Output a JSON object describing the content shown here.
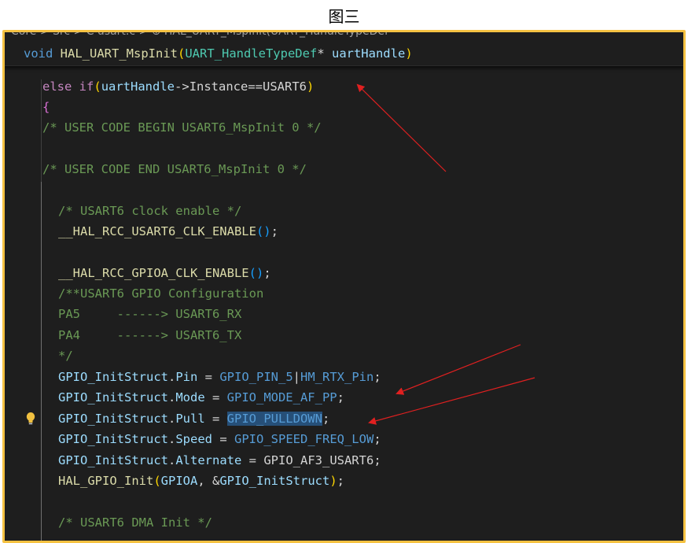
{
  "caption": "图三",
  "breadcrumb": "Core > Src > C usart.c > ⊕ HAL_UART_MspInit(UART_HandleTypeDef *",
  "sticky": {
    "t1": "void",
    "t2": "HAL_UART_MspInit",
    "t3": "(",
    "t4": "UART_HandleTypeDef",
    "t5": "* ",
    "t6": "uartHandle",
    "t7": ")"
  },
  "lines": {
    "l1": {
      "t1": "else",
      "t2": " ",
      "t3": "if",
      "t4": "(",
      "t5": "uartHandle",
      "t6": "->",
      "t7": "Instance",
      "t8": "==",
      "t9": "USART6",
      "t10": ")"
    },
    "l2": {
      "t1": "{"
    },
    "l3": {
      "t1": "/* USER CODE BEGIN USART6_MspInit 0 */"
    },
    "l5": {
      "t1": "/* USER CODE END USART6_MspInit 0 */"
    },
    "l7": {
      "t1": "/* USART6 clock enable */"
    },
    "l8": {
      "t1": "__HAL_RCC_USART6_CLK_ENABLE",
      "t2": "()",
      "t3": ";"
    },
    "l10": {
      "t1": "__HAL_RCC_GPIOA_CLK_ENABLE",
      "t2": "()",
      "t3": ";"
    },
    "l11": {
      "t1": "/**USART6 GPIO Configuration"
    },
    "l12": {
      "t1": "PA5     ------> USART6_RX"
    },
    "l13": {
      "t1": "PA4     ------> USART6_TX"
    },
    "l14": {
      "t1": "*/"
    },
    "l15": {
      "t1": "GPIO_InitStruct",
      "t2": ".",
      "t3": "Pin",
      "t4": " = ",
      "t5": "GPIO_PIN_5",
      "t6": "|",
      "t7": "HM_RTX_Pin",
      "t8": ";"
    },
    "l16": {
      "t1": "GPIO_InitStruct",
      "t2": ".",
      "t3": "Mode",
      "t4": " = ",
      "t5": "GPIO_MODE_AF_PP",
      "t6": ";"
    },
    "l17": {
      "t1": "GPIO_InitStruct",
      "t2": ".",
      "t3": "Pull",
      "t4": " = ",
      "t5": "GPIO_PULLDOWN",
      "t6": ";"
    },
    "l18": {
      "t1": "GPIO_InitStruct",
      "t2": ".",
      "t3": "Speed",
      "t4": " = ",
      "t5": "GPIO_SPEED_FREQ_LOW",
      "t6": ";"
    },
    "l19": {
      "t1": "GPIO_InitStruct",
      "t2": ".",
      "t3": "Alternate",
      "t4": " = ",
      "t5": "GPIO_AF3_USART6",
      "t6": ";"
    },
    "l20": {
      "t1": "HAL_GPIO_Init",
      "t2": "(",
      "t3": "GPIOA",
      "t4": ", &",
      "t5": "GPIO_InitStruct",
      "t6": ")",
      "t7": ";"
    },
    "l22": {
      "t1": "/* USART6 DMA Init */"
    }
  },
  "colors": {
    "frame_border": "#f5c242",
    "editor_bg": "#1e1e1e",
    "arrow": "#e02020",
    "lightbulb": "#f0c040"
  },
  "icons": {
    "gutter": "lightbulb-icon"
  }
}
